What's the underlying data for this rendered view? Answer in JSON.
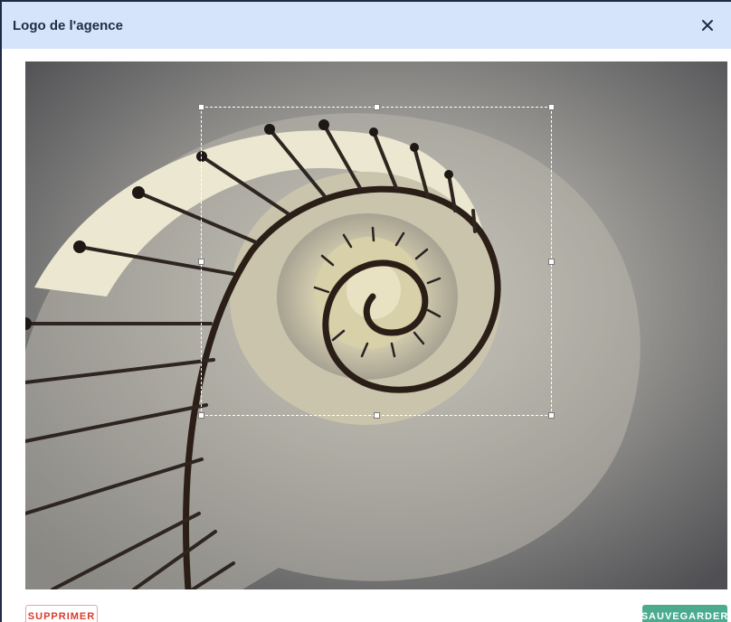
{
  "dialog": {
    "title": "Logo de l'agence",
    "close_icon": "close-icon"
  },
  "editor": {
    "image_description_icon": "photo-spiral-staircase"
  },
  "footer": {
    "delete_label": "SUPPRIMER",
    "save_label": "SAUVEGARDER"
  },
  "colors": {
    "header_bg": "#d6e4fb",
    "delete": "#d93a2b",
    "save": "#4aab8e"
  }
}
